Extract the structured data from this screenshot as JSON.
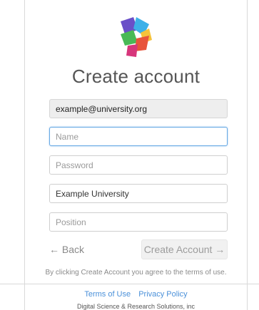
{
  "page": {
    "title": "Create account"
  },
  "logo": {
    "icon": "dimensions-logo-icon",
    "colors": [
      "#6a4fc8",
      "#3db1e8",
      "#f5c23a",
      "#e8543b",
      "#49b956",
      "#d7367b"
    ]
  },
  "form": {
    "email_value": "example@university.org",
    "name_placeholder": "Name",
    "password_placeholder": "Password",
    "university_value": "Example University",
    "position_placeholder": "Position"
  },
  "actions": {
    "back_label": "← Back",
    "create_label": "Create Account →"
  },
  "terms_note": "By clicking Create Account you agree to the terms of use.",
  "footer": {
    "terms_label": "Terms of Use",
    "privacy_label": "Privacy Policy",
    "company": "Digital Science & Research Solutions, inc"
  },
  "colors": {
    "link": "#4a90d9",
    "focus": "#66a8e4"
  }
}
